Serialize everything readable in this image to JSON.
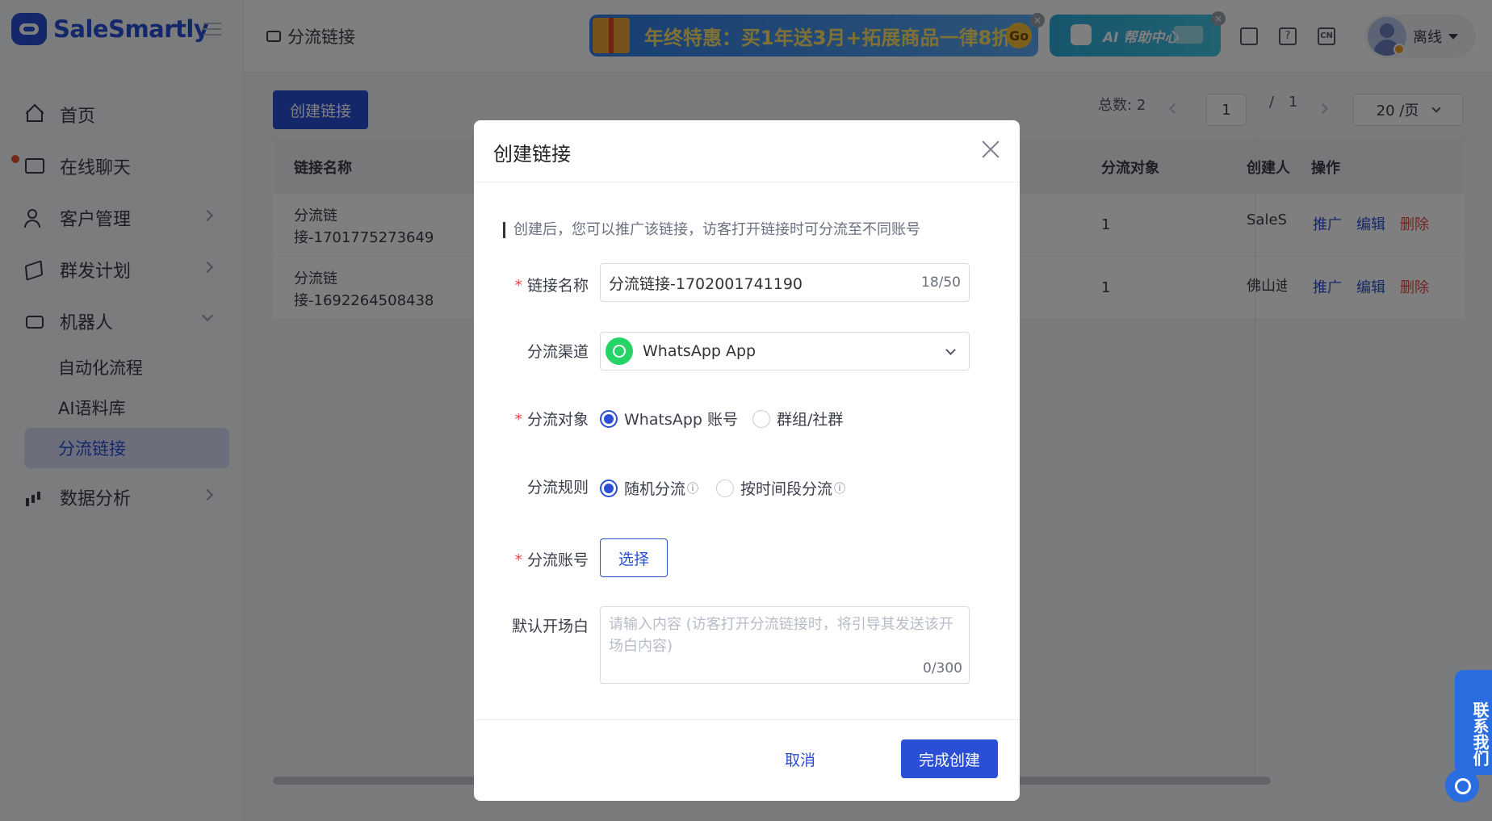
{
  "app": {
    "logo_text": "SaleSmartly"
  },
  "sidebar": {
    "items": [
      {
        "label": "首页",
        "icon": "home-icon"
      },
      {
        "label": "在线聊天",
        "icon": "chat-icon",
        "badge": "red-dot"
      },
      {
        "label": "客户管理",
        "icon": "users-icon"
      },
      {
        "label": "群发计划",
        "icon": "send-icon"
      },
      {
        "label": "机器人",
        "icon": "robot-icon"
      }
    ],
    "robot_sub": [
      "自动化流程",
      "AI语料库",
      "分流链接"
    ],
    "analytics": {
      "label": "数据分析",
      "icon": "chart-icon"
    }
  },
  "header": {
    "breadcrumb": "分流链接",
    "promo_text": "年终特惠：买1年送3月+拓展商品一律8折",
    "promo_go": "Go",
    "ai_help": "AI 帮助中心",
    "lang": "CN",
    "user_status": "离线"
  },
  "main": {
    "create_button": "创建链接",
    "total_label": "总数: 2",
    "page_current": "1",
    "page_sep": "/",
    "page_total": "1",
    "page_size": "20 /页",
    "table": {
      "headers": [
        "链接名称",
        "分流对象",
        "创建人",
        "操作"
      ],
      "rows": [
        {
          "name_line1": "分流链",
          "name_line2": "接-1701775273649",
          "count": "1",
          "creator": "SaleSmartly"
        },
        {
          "name_line1": "分流链",
          "name_line2": "接-1692264508438",
          "count": "1",
          "creator": "佛山迪"
        }
      ],
      "actions": {
        "promote": "推广",
        "edit": "编辑",
        "delete": "删除"
      }
    }
  },
  "modal": {
    "title": "创建链接",
    "hint": "创建后，您可以推广该链接，访客打开链接时可分流至不同账号",
    "fields": {
      "name_label": "链接名称",
      "name_value": "分流链接-1702001741190",
      "name_count": "18/50",
      "channel_label": "分流渠道",
      "channel_value": "WhatsApp App",
      "target_label": "分流对象",
      "target_options": [
        "WhatsApp 账号",
        "群组/社群"
      ],
      "rule_label": "分流规则",
      "rule_options": [
        "随机分流",
        "按时间段分流"
      ],
      "account_label": "分流账号",
      "select_button": "选择",
      "greeting_label": "默认开场白",
      "greeting_placeholder": "请输入内容 (访客打开分流链接时，将引导其发送该开场白内容)",
      "greeting_count": "0/300"
    },
    "cancel": "取消",
    "confirm": "完成创建"
  },
  "contact": {
    "label": "联系我们"
  },
  "colors": {
    "primary": "#2a4fd6",
    "danger": "#e84848",
    "whatsapp": "#25d366"
  }
}
